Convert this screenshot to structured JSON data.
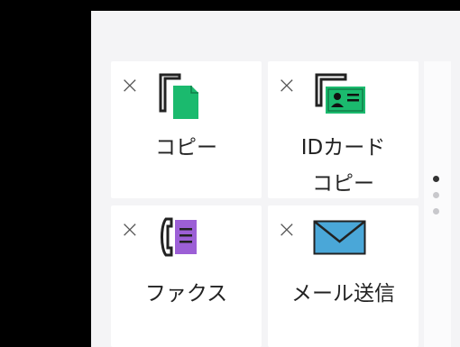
{
  "tiles": [
    {
      "label_lines": [
        "コピー"
      ],
      "remove_symbol": "×",
      "icon": "copy-icon",
      "icon_color": "#1bba6e"
    },
    {
      "label_lines": [
        "IDカード",
        "コピー"
      ],
      "remove_symbol": "×",
      "icon": "id-card-copy-icon",
      "icon_color": "#1bba6e"
    },
    {
      "label_lines": [
        "ファクス"
      ],
      "remove_symbol": "×",
      "icon": "fax-icon",
      "icon_color": "#9c5fd6"
    },
    {
      "label_lines": [
        "メール送信"
      ],
      "remove_symbol": "×",
      "icon": "mail-icon",
      "icon_color": "#4aa7d8"
    }
  ],
  "pager": {
    "pages": 3,
    "current": 1
  }
}
